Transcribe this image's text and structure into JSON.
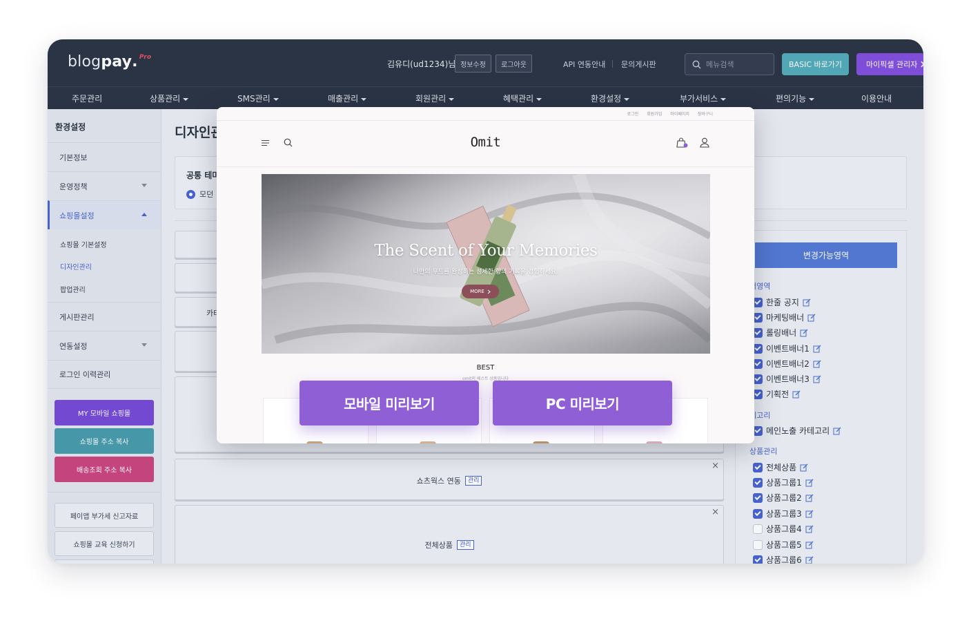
{
  "header": {
    "logo_main": "blog",
    "logo_bold": "pay",
    "logo_dot": ".",
    "logo_pro": "Pro",
    "user": "김유디(ud1234)님",
    "edit_info": "정보수정",
    "logout": "로그아웃",
    "api_guide": "API 연동안내",
    "board": "문의게시판",
    "search_placeholder": "메뉴검색",
    "basic_btn": "BASIC 바로가기",
    "mypick_btn": "마이픽셀 관리자"
  },
  "nav": [
    {
      "label": "주문관리",
      "caret": false
    },
    {
      "label": "상품관리",
      "caret": true
    },
    {
      "label": "SMS관리",
      "caret": true
    },
    {
      "label": "매출관리",
      "caret": true
    },
    {
      "label": "회원관리",
      "caret": true
    },
    {
      "label": "혜택관리",
      "caret": true
    },
    {
      "label": "환경설정",
      "caret": true
    },
    {
      "label": "부가서비스",
      "caret": true
    },
    {
      "label": "편의기능",
      "caret": true
    },
    {
      "label": "이용안내",
      "caret": false
    }
  ],
  "sidebar": {
    "title": "환경설정",
    "items": [
      "기본정보",
      "운영정책",
      "쇼핑몰설정",
      "게시판관리",
      "연동설정",
      "로그인 이력관리"
    ],
    "sub_items": [
      "쇼핑몰 기본설정",
      "디자인관리",
      "팝업관리"
    ],
    "buttons": [
      "MY 모바일 쇼핑몰",
      "쇼핑몰 주소 복사",
      "배송조회 주소 복사"
    ],
    "outline_buttons": [
      "페이앱 부가세 신고자료",
      "쇼핑몰 교육 신청하기"
    ]
  },
  "content": {
    "page_title": "디자인관",
    "theme_title": "공통 테마",
    "theme_option": "모던",
    "partial_label": "카테",
    "box1_label": "쇼츠웍스 연동",
    "box2_label": "전체상품",
    "manage_tag": "관리",
    "close_glyph": "×"
  },
  "right_panel": {
    "title": "변경가능영역",
    "groups": [
      {
        "name": "너영역",
        "items": [
          {
            "label": "한줄 공지",
            "checked": true
          },
          {
            "label": "마케팅배너",
            "checked": true
          },
          {
            "label": "롤링배너",
            "checked": true
          },
          {
            "label": "이벤트배너1",
            "checked": true
          },
          {
            "label": "이벤트배너2",
            "checked": true
          },
          {
            "label": "이벤트배너3",
            "checked": true
          },
          {
            "label": "기획전",
            "checked": true
          }
        ]
      },
      {
        "name": "테고리",
        "items": [
          {
            "label": "메인노출 카테고리",
            "checked": true
          }
        ]
      },
      {
        "name": "상품관리",
        "items": [
          {
            "label": "전체상품",
            "checked": true
          },
          {
            "label": "상품그룹1",
            "checked": true
          },
          {
            "label": "상품그룹2",
            "checked": true
          },
          {
            "label": "상품그룹3",
            "checked": true
          },
          {
            "label": "상품그룹4",
            "checked": false
          },
          {
            "label": "상품그룹5",
            "checked": false
          },
          {
            "label": "상품그룹6",
            "checked": true
          }
        ]
      }
    ]
  },
  "preview": {
    "util_links": [
      "로그인",
      "회원가입",
      "마이페이지",
      "장바구니"
    ],
    "shop_name": "Omit",
    "hero_title": "The Scent of Your Memories",
    "hero_sub": "나만의 무드를 완성하는 섬세한 향의 기록을 경험하세요.",
    "more": "MORE",
    "best": "BEST",
    "best_sub": "omit의 베스트 상품입니다",
    "mobile_btn": "모바일 미리보기",
    "pc_btn": "PC 미리보기"
  },
  "colors": {
    "header_bg": "#1f2838",
    "accent": "#3d5bd0",
    "basic": "#4aa7b6",
    "mypick": "#7b45dd",
    "preview_btn": "#8f5fd6"
  }
}
